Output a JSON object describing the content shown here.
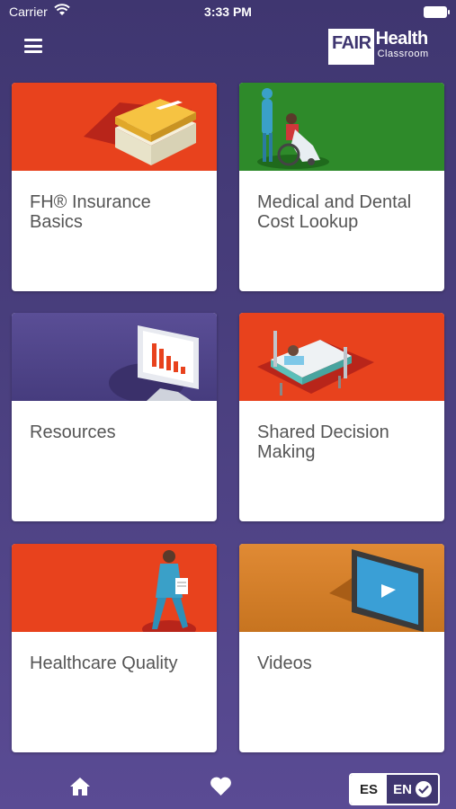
{
  "status_bar": {
    "carrier": "Carrier",
    "time": "3:33 PM"
  },
  "header": {
    "logo_fair": "FAIR",
    "logo_health": "Health",
    "logo_classroom": "Classroom"
  },
  "cards": [
    {
      "title": "FH® Insurance Basics",
      "banner_color": "#e8421d"
    },
    {
      "title": "Medical and Dental Cost Lookup",
      "banner_color": "#2e8a2a"
    },
    {
      "title": "Resources",
      "banner_color": "#4a3f80"
    },
    {
      "title": "Shared Decision Making",
      "banner_color": "#e8421d"
    },
    {
      "title": "Healthcare Quality",
      "banner_color": "#e8421d"
    },
    {
      "title": "Videos",
      "banner_color": "#d7852e"
    }
  ],
  "bottom_bar": {
    "lang_es": "ES",
    "lang_en": "EN",
    "active_lang": "EN"
  },
  "colors": {
    "background": "#453b78",
    "accent": "#e8421d",
    "card_text": "#555555"
  }
}
